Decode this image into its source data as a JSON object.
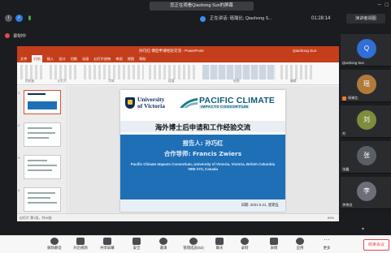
{
  "meeting": {
    "share_banner": "您正在观看Qiaohong Sun的屏幕",
    "speaking": "正在讲话: 瑶瑜比; Qiaohong S...",
    "timer": "01:28:14",
    "view_button": "演讲者视图",
    "recording": "录制中"
  },
  "ppt": {
    "doc_title": "孙巧红-博后申请经验交流 - PowerPoint",
    "user": "Qiaohong Sun",
    "tabs": [
      "文件",
      "开始",
      "插入",
      "设计",
      "切换",
      "动画",
      "幻灯片放映",
      "审阅",
      "视图",
      "帮助"
    ],
    "ribbon_groups": [
      "剪贴板",
      "幻灯片",
      "字体",
      "段落",
      "绘图",
      "编辑"
    ],
    "status_left": "幻灯片 第1张，共28张",
    "zoom": "69%"
  },
  "slide": {
    "uvic_line1": "University",
    "uvic_line2": "of Victoria",
    "pcic_name": "PACIFIC CLIMATE",
    "pcic_sub": "IMPACTS CONSORTIUM",
    "title": "海外博士后申请和工作经验交流",
    "reporter": "报告人: 孙巧红",
    "advisor": "合作导师: Francis Zwiers",
    "affiliation": "Pacific Climate Impacts Consortium, University of Victoria, Victoria, British Columbia V8W 2Y2, Canada",
    "date": "日期: 2021.5.21, 星期五"
  },
  "participants": [
    {
      "name": "Qiaohong Sun",
      "initial": "Q",
      "color": "#2f6fd6"
    },
    {
      "name": "瑶瑜比",
      "initial": "瑶",
      "color": "#b07a3a"
    },
    {
      "name": "刘",
      "initial": "刘",
      "color": "#7d8d3b"
    },
    {
      "name": "张鑫",
      "initial": "张",
      "color": "#5a5f66"
    },
    {
      "name": "李晓龙",
      "initial": "李",
      "color": "#6b7078"
    }
  ],
  "toolbar": {
    "buttons": [
      "解除静音",
      "开启视频",
      "共享屏幕",
      "安全",
      "邀请",
      "管理成员(53)",
      "聊天",
      "录制",
      "表情",
      "应用",
      "更多"
    ],
    "end": "结束会议"
  }
}
